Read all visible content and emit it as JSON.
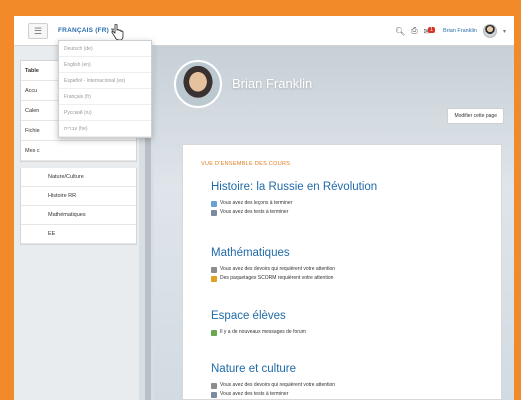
{
  "topbar": {
    "menu_icon": "hamburger-icon",
    "language_label": "FRANÇAIS (FR)",
    "search_icon": "search-icon",
    "print_icon": "print-icon",
    "notifications_icon": "chat-icon",
    "notifications_badge": "1",
    "user_name": "Brian Franklin"
  },
  "language_dropdown": {
    "options": [
      "Deutsch (de)",
      "English (en)",
      "Español - Internacional (es)",
      "Français (fr)",
      "Русский (ru)",
      "עברית (he)"
    ]
  },
  "sidebar": {
    "items": [
      "Table",
      "Accu",
      "Calen",
      "Fichie",
      "Mes c"
    ],
    "courses": [
      "Nature/Culture",
      "Histoire RR",
      "Mathématiques",
      "EE"
    ]
  },
  "profile": {
    "name": "Brian Franklin",
    "edit_button": "Modifier cette page"
  },
  "overview": {
    "title": "VUE D'ENSEMBLE DES COURS",
    "courses": [
      {
        "name": "Histoire: la Russie en Révolution",
        "lines": [
          {
            "icon": "lesson-icon",
            "text": "Vous avez des leçons à terminer"
          },
          {
            "icon": "quiz-icon",
            "text": "Vous avez des tests à terminer"
          }
        ]
      },
      {
        "name": "Mathématiques",
        "lines": [
          {
            "icon": "assignment-icon",
            "text": "Vous avez des devoirs qui requièrent votre attention"
          },
          {
            "icon": "scorm-icon",
            "text": "Des paquetages SCORM requièrent votre attention"
          }
        ]
      },
      {
        "name": "Espace élèves",
        "lines": [
          {
            "icon": "forum-icon",
            "text": "Il y a de nouveaux messages de forum"
          }
        ]
      },
      {
        "name": "Nature et culture",
        "lines": [
          {
            "icon": "assignment-icon",
            "text": "Vous avez des devoirs qui requièrent votre attention"
          },
          {
            "icon": "quiz-icon",
            "text": "Vous avez des tests à terminer"
          }
        ]
      }
    ]
  },
  "colors": {
    "frame_border": "#f28a2a",
    "link_blue": "#1f6aa8",
    "section_orange": "#e07b22"
  }
}
